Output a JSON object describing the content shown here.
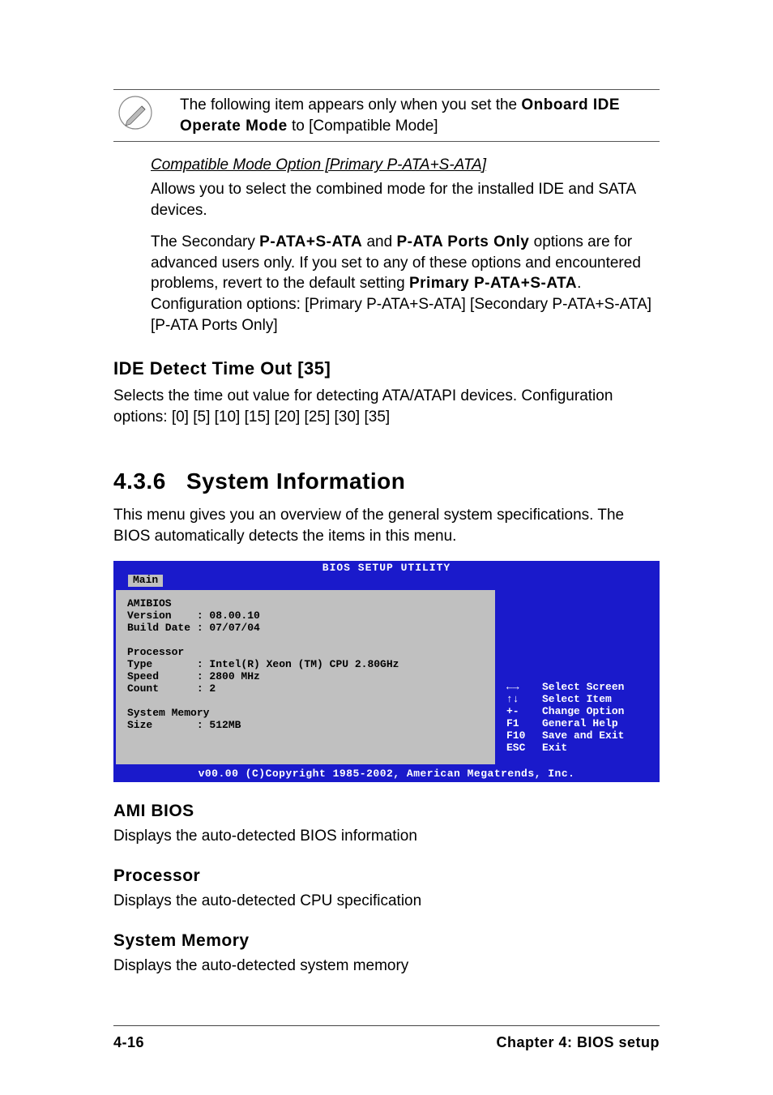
{
  "note": {
    "prefix": "The following item appears only when you set the ",
    "bold1": "Onboard IDE Operate Mode",
    "suffix": " to [Compatible Mode]"
  },
  "compat": {
    "title": "Compatible Mode Option  [Primary P-ATA+S-ATA]",
    "p1": "Allows you to select the combined mode for the installed IDE and SATA devices.",
    "p2a": "The Secondary ",
    "p2b": "P-ATA+S-ATA",
    "p2c": " and ",
    "p2d": "P-ATA Ports Only",
    "p2e": " options are for advanced users only. If you set to any of these options and encountered problems, revert to the default setting ",
    "p2f": "Primary P-ATA+S-ATA",
    "p2g": ". Configuration options: [Primary P-ATA+S-ATA] [Secondary P-ATA+S-ATA] [P-ATA Ports Only]"
  },
  "ide_timeout": {
    "title": "IDE Detect Time Out [35]",
    "body": "Selects the time out value for detecting ATA/ATAPI devices. Configuration options: [0] [5] [10] [15] [20] [25] [30] [35]"
  },
  "section": {
    "num": "4.3.6",
    "title": "System Information",
    "intro": "This menu gives you an overview of the general system specifications. The BIOS automatically detects the items in this menu."
  },
  "bios": {
    "header": "BIOS SETUP UTILITY",
    "tab": "Main",
    "left_text": "AMIBIOS\nVersion    : 08.00.10\nBuild Date : 07/07/04\n\nProcessor\nType       : Intel(R) Xeon (TM) CPU 2.80GHz\nSpeed      : 2800 MHz\nCount      : 2\n\nSystem Memory\nSize       : 512MB",
    "help": [
      {
        "key": "←→",
        "desc": "Select Screen"
      },
      {
        "key": "↑↓",
        "desc": "Select Item"
      },
      {
        "key": "+-",
        "desc": "Change Option"
      },
      {
        "key": "F1",
        "desc": "General Help"
      },
      {
        "key": "F10",
        "desc": "Save and Exit"
      },
      {
        "key": "ESC",
        "desc": "Exit"
      }
    ],
    "footer": "v00.00 (C)Copyright 1985-2002, American Megatrends, Inc."
  },
  "ami": {
    "title": "AMI BIOS",
    "body": "Displays the auto-detected BIOS information"
  },
  "proc": {
    "title": "Processor",
    "body": "Displays the auto-detected CPU specification"
  },
  "mem": {
    "title": "System Memory",
    "body": "Displays the auto-detected system memory"
  },
  "footer": {
    "left": "4-16",
    "right": "Chapter 4: BIOS setup"
  }
}
